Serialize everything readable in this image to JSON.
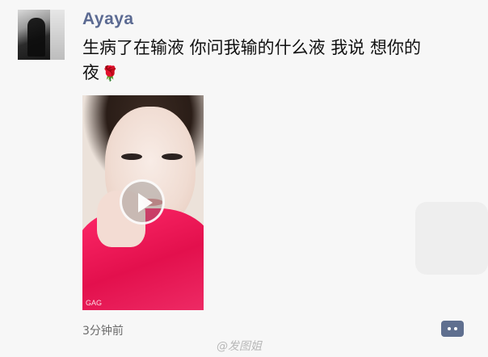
{
  "post": {
    "username": "Ayaya",
    "text_line1": "生病了在输液 你问我输的什么液 我说 想你的",
    "text_line2": "夜",
    "emoji": "🌹",
    "video": {
      "thumb_watermark": "GAG"
    },
    "time": "3分钟前"
  },
  "icons": {
    "play": "play-icon",
    "comment": "comment-icon"
  },
  "watermark": "@发图姐",
  "colors": {
    "username": "#5b6a92",
    "comment_button": "#5f6f8f",
    "garment": "#e3104d"
  }
}
